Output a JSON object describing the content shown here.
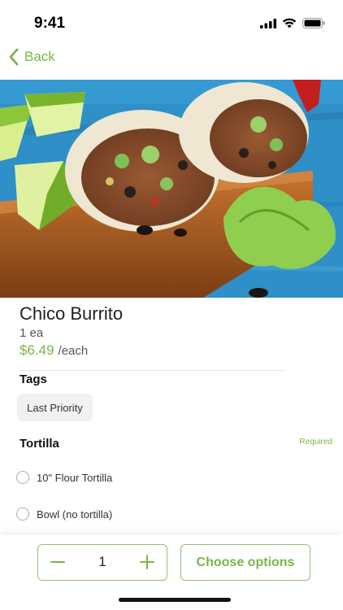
{
  "status_bar": {
    "time": "9:41"
  },
  "nav": {
    "back_label": "Back"
  },
  "product": {
    "name": "Chico Burrito",
    "quantity_unit": "1 ea",
    "price": "$6.49",
    "price_unit": "/each"
  },
  "tags": {
    "heading": "Tags",
    "items": [
      "Last Priority"
    ]
  },
  "tortilla": {
    "heading": "Tortilla",
    "required_label": "Required",
    "options": [
      "10\" Flour Tortilla",
      "Bowl (no tortilla)"
    ]
  },
  "footer": {
    "quantity": "1",
    "choose_label": "Choose options"
  },
  "colors": {
    "accent": "#7ab547",
    "border_accent": "#8cc26c"
  },
  "icons": [
    "signal-icon",
    "wifi-icon",
    "battery-icon",
    "chevron-left-icon",
    "minus-icon",
    "plus-icon"
  ]
}
